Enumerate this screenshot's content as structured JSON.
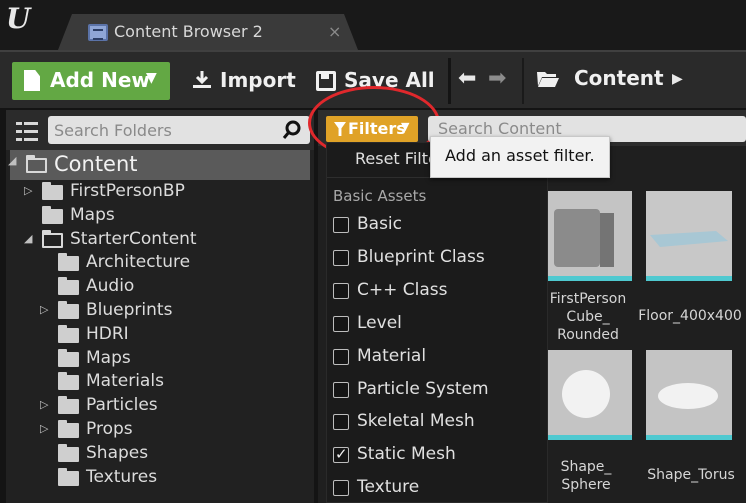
{
  "tab": {
    "title": "Content Browser 2",
    "close": "×"
  },
  "toolbar": {
    "add_new_label": "Add New",
    "import_label": "Import",
    "save_all_label": "Save All",
    "breadcrumb_label": "Content"
  },
  "folders": {
    "search_placeholder": "Search Folders",
    "tree": [
      {
        "label": "Content",
        "depth": 0,
        "arrow": "◢",
        "open": true,
        "selected": true
      },
      {
        "label": "FirstPersonBP",
        "depth": 1,
        "arrow": "▷",
        "open": false
      },
      {
        "label": "Maps",
        "depth": 1,
        "arrow": "",
        "open": false
      },
      {
        "label": "StarterContent",
        "depth": 1,
        "arrow": "◢",
        "open": true
      },
      {
        "label": "Architecture",
        "depth": 2,
        "arrow": "",
        "open": false
      },
      {
        "label": "Audio",
        "depth": 2,
        "arrow": "",
        "open": false
      },
      {
        "label": "Blueprints",
        "depth": 2,
        "arrow": "▷",
        "open": false
      },
      {
        "label": "HDRI",
        "depth": 2,
        "arrow": "",
        "open": false
      },
      {
        "label": "Maps",
        "depth": 2,
        "arrow": "",
        "open": false
      },
      {
        "label": "Materials",
        "depth": 2,
        "arrow": "",
        "open": false
      },
      {
        "label": "Particles",
        "depth": 2,
        "arrow": "▷",
        "open": false
      },
      {
        "label": "Props",
        "depth": 2,
        "arrow": "▷",
        "open": false
      },
      {
        "label": "Shapes",
        "depth": 2,
        "arrow": "",
        "open": false
      },
      {
        "label": "Textures",
        "depth": 2,
        "arrow": "",
        "open": false
      }
    ]
  },
  "content": {
    "filters_label": "Filters",
    "search_placeholder": "Search Content",
    "assets": [
      {
        "name": "FirstPerson\nCube_\nRounded",
        "icon": "cube-thumbnail"
      },
      {
        "name": "Floor_400x400",
        "icon": "floor-thumbnail"
      },
      {
        "name": "Shape_\nSphere",
        "icon": "sphere-thumbnail"
      },
      {
        "name": "Shape_Torus",
        "icon": "torus-thumbnail"
      }
    ]
  },
  "filter_menu": {
    "reset_label": "Reset Filters",
    "section_header": "Basic Assets",
    "items": [
      {
        "label": "Basic",
        "checked": false
      },
      {
        "label": "Blueprint Class",
        "checked": false
      },
      {
        "label": "C++ Class",
        "checked": false
      },
      {
        "label": "Level",
        "checked": false
      },
      {
        "label": "Material",
        "checked": false
      },
      {
        "label": "Particle System",
        "checked": false
      },
      {
        "label": "Skeletal Mesh",
        "checked": false
      },
      {
        "label": "Static Mesh",
        "checked": true
      },
      {
        "label": "Texture",
        "checked": false
      }
    ]
  },
  "tooltip": {
    "text": "Add an asset filter."
  },
  "colors": {
    "add_new": "#63a844",
    "filters": "#e0a227",
    "highlight_ring": "#e0282c",
    "tile_strip": "#4fc9d0"
  }
}
